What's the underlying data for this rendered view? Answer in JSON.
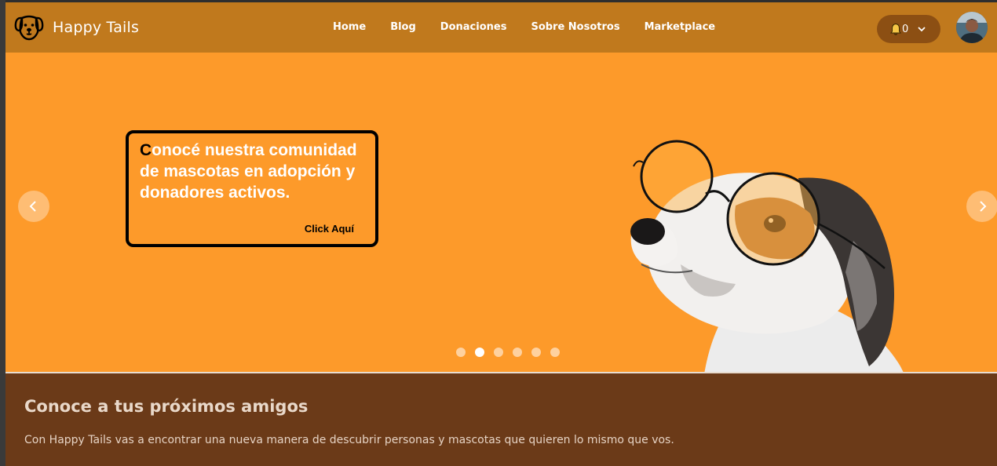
{
  "brand": {
    "name": "Happy Tails",
    "logo_icon": "dog-face-icon"
  },
  "nav": {
    "items": [
      {
        "label": "Home"
      },
      {
        "label": "Blog"
      },
      {
        "label": "Donaciones"
      },
      {
        "label": "Sobre Nosotros"
      },
      {
        "label": "Marketplace"
      }
    ]
  },
  "notifications": {
    "count": "0",
    "icon": "bell-icon",
    "dropdown_icon": "chevron-down-icon"
  },
  "user": {
    "avatar_icon": "avatar"
  },
  "colors": {
    "navbar": "#c0791d",
    "hero": "#fd9a2a",
    "section": "#6b3a18",
    "notification_pill": "#8c4f13"
  },
  "hero": {
    "headline_first_letter": "C",
    "headline_rest": "onocé nuestra comunidad de mascotas en adopción y donadores activos.",
    "cta": "Click Aquí",
    "prev_icon": "chevron-left-icon",
    "next_icon": "chevron-right-icon",
    "slides": {
      "total": 6,
      "active": 2
    },
    "image": "dog-with-glasses"
  },
  "section": {
    "title": "Conoce a tus próximos amigos",
    "text": "Con Happy Tails vas a encontrar una nueva manera de descubrir personas y mascotas que quieren lo mismo que vos."
  }
}
